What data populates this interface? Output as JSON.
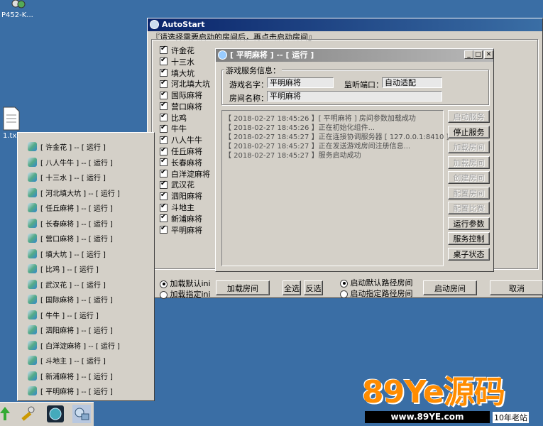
{
  "desktop": {
    "icon1_label": "P452-K...",
    "icon2_label": "1.tx"
  },
  "main_window": {
    "title": "AutoStart",
    "instruction": "『请选择需要启动的房间后，再点击启动房间』",
    "rooms": [
      "许金花",
      "十三水",
      "填大坑",
      "河北填大坑",
      "国际麻将",
      "营口麻将",
      "比鸡",
      "牛牛",
      "八人牛牛",
      "任丘麻将",
      "长春麻将",
      "白洋淀麻将",
      "武汉花",
      "泗阳麻将",
      "斗地主",
      "新浦麻将",
      "平明麻将"
    ],
    "radio_load_default": "加载默认ini",
    "radio_load_specified": "加载指定ini",
    "btn_load_room": "加载房间",
    "btn_select_all": "全选",
    "btn_invert": "反选",
    "radio_default_path": "启动默认路径房间",
    "radio_specified_path": "启动指定路径房间",
    "btn_start_room": "启动房间",
    "btn_cancel": "取消"
  },
  "sub_window": {
    "title": "[ 平明麻将 ] -- [ 运行 ]",
    "group_label": "游戏服务信息：",
    "game_name_label": "游戏名字：",
    "game_name_value": "平明麻将",
    "port_label": "监听端口：",
    "port_value": "自动适配",
    "room_name_label": "房间名称：",
    "room_name_value": "平明麻将",
    "log": [
      "【 2018-02-27 18:45:26 】[ 平明麻将 ] 房间参数加载成功",
      "【 2018-02-27 18:45:26 】正在初始化组件...",
      "【 2018-02-27 18:45:27 】正在连接协调服务器 [ 127.0.0.1:8410 ]",
      "【 2018-02-27 18:45:27 】正在发送游戏房间注册信息...",
      "【 2018-02-27 18:45:27 】服务启动成功"
    ],
    "buttons": [
      {
        "label": "启动服务",
        "enabled": false
      },
      {
        "label": "停止服务",
        "enabled": true
      },
      {
        "label": "加载房间",
        "enabled": false
      },
      {
        "label": "加载房间",
        "enabled": false
      },
      {
        "label": "创建房间",
        "enabled": false
      },
      {
        "label": "配置房间",
        "enabled": false
      },
      {
        "label": "配置比赛",
        "enabled": false
      },
      {
        "label": "运行参数",
        "enabled": true
      },
      {
        "label": "服务控制",
        "enabled": true
      },
      {
        "label": "桌子状态",
        "enabled": true
      }
    ]
  },
  "popup_menu": {
    "items": [
      "[ 许金花 ] -- [ 运行 ]",
      "[ 八人牛牛 ] -- [ 运行 ]",
      "[ 十三水 ] -- [ 运行 ]",
      "[ 河北填大坑 ] -- [ 运行 ]",
      "[ 任丘麻将 ] -- [ 运行 ]",
      "[ 长春麻将 ] -- [ 运行 ]",
      "[ 营口麻将 ] -- [ 运行 ]",
      "[ 填大坑 ] -- [ 运行 ]",
      "[ 比鸡 ] -- [ 运行 ]",
      "[ 武汉花 ] -- [ 运行 ]",
      "[ 国际麻将 ] -- [ 运行 ]",
      "[ 牛牛 ] -- [ 运行 ]",
      "[ 泗阳麻将 ] -- [ 运行 ]",
      "[ 白洋淀麻将 ] -- [ 运行 ]",
      "[ 斗地主 ] -- [ 运行 ]",
      "[ 新浦麻将 ] -- [ 运行 ]",
      "[ 平明麻将 ] -- [ 运行 ]"
    ]
  },
  "watermark": {
    "brand": "89Ye源码",
    "url": "www.89YE.com",
    "tag": "10年老站"
  },
  "colors": {
    "desktop": "#3a6ea5",
    "title_active": "#0a246a",
    "watermark_orange": "#ff8c00"
  }
}
